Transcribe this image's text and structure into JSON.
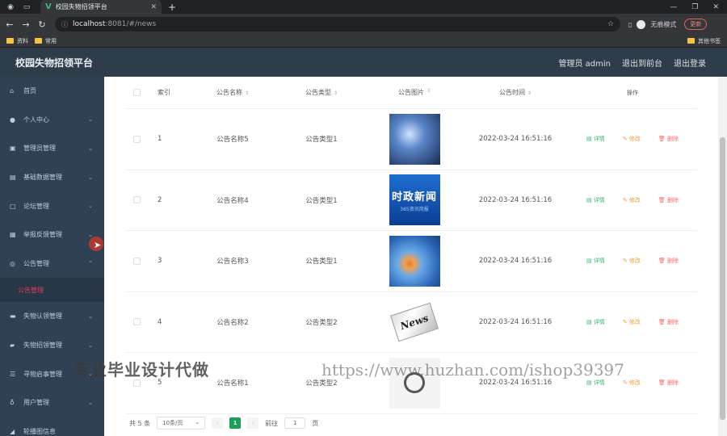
{
  "browser": {
    "tab_title": "校园失物招领平台",
    "url_host": "localhost",
    "url_rest": ":8081/#/news",
    "profile_label": "无痕模式",
    "update_label": "更新",
    "bookmarks": [
      "资料",
      "常用"
    ],
    "bookmark_right": "其他书签"
  },
  "header": {
    "title": "校园失物招领平台",
    "links": [
      "管理员 admin",
      "退出到前台",
      "退出登录"
    ]
  },
  "sidebar": {
    "items": [
      {
        "label": "首页",
        "icon": "home-icon"
      },
      {
        "label": "个人中心",
        "icon": "user-icon"
      },
      {
        "label": "管理员管理",
        "icon": "admin-icon"
      },
      {
        "label": "基础数据管理",
        "icon": "data-icon"
      },
      {
        "label": "论坛管理",
        "icon": "forum-icon"
      },
      {
        "label": "举报反馈管理",
        "icon": "report-icon"
      },
      {
        "label": "公告管理",
        "icon": "notice-icon"
      },
      {
        "label": "失物认领管理",
        "icon": "claim-icon"
      },
      {
        "label": "失物招领管理",
        "icon": "lost-icon"
      },
      {
        "label": "寻物启事管理",
        "icon": "search-notice-icon"
      },
      {
        "label": "用户管理",
        "icon": "users-icon"
      },
      {
        "label": "轮播图信息",
        "icon": "carousel-icon"
      }
    ],
    "sub_item": "公告管理"
  },
  "table": {
    "headers": {
      "index": "索引",
      "name": "公告名称",
      "type": "公告类型",
      "image": "公告图片",
      "time": "公告时间",
      "ops": "操作"
    },
    "ops": {
      "detail": "详情",
      "edit": "修改",
      "delete": "删除"
    },
    "rows": [
      {
        "index": "1",
        "name": "公告名称5",
        "type": "公告类型1",
        "time": "2022-03-24 16:51:16"
      },
      {
        "index": "2",
        "name": "公告名称4",
        "type": "公告类型1",
        "time": "2022-03-24 16:51:16"
      },
      {
        "index": "3",
        "name": "公告名称3",
        "type": "公告类型1",
        "time": "2022-03-24 16:51:16"
      },
      {
        "index": "4",
        "name": "公告名称2",
        "type": "公告类型2",
        "time": "2022-03-24 16:51:16"
      },
      {
        "index": "5",
        "name": "公告名称1",
        "type": "公告类型2",
        "time": "2022-03-24 16:51:16"
      }
    ],
    "thumb_text": {
      "t2_big": "时政新闻",
      "t2_small": "365资讯简报",
      "t4": "News"
    }
  },
  "pager": {
    "total": "共 5 条",
    "size": "10条/页",
    "current": "1",
    "goto_label": "前往",
    "goto_value": "1",
    "page_suffix": "页"
  },
  "watermark": {
    "left": "专业毕业设计代做",
    "right": "https://www.huzhan.com/ishop39397"
  }
}
